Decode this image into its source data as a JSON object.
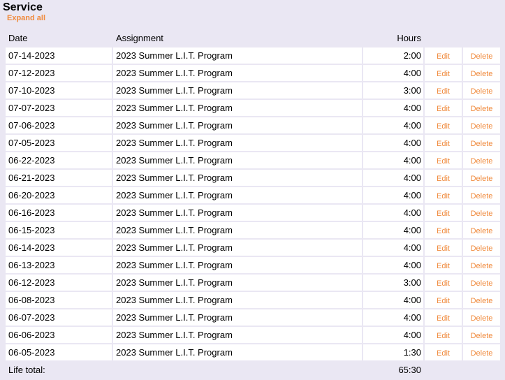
{
  "section": {
    "title": "Service",
    "expand_label": "Expand all"
  },
  "table": {
    "headers": {
      "date": "Date",
      "assignment": "Assignment",
      "hours": "Hours"
    },
    "edit_label": "Edit",
    "delete_label": "Delete",
    "rows": [
      {
        "date": "07-14-2023",
        "assignment": "2023 Summer L.I.T. Program",
        "hours": "2:00"
      },
      {
        "date": "07-12-2023",
        "assignment": "2023 Summer L.I.T. Program",
        "hours": "4:00"
      },
      {
        "date": "07-10-2023",
        "assignment": "2023 Summer L.I.T. Program",
        "hours": "3:00"
      },
      {
        "date": "07-07-2023",
        "assignment": "2023 Summer L.I.T. Program",
        "hours": "4:00"
      },
      {
        "date": "07-06-2023",
        "assignment": "2023 Summer L.I.T. Program",
        "hours": "4:00"
      },
      {
        "date": "07-05-2023",
        "assignment": "2023 Summer L.I.T. Program",
        "hours": "4:00"
      },
      {
        "date": "06-22-2023",
        "assignment": "2023 Summer L.I.T. Program",
        "hours": "4:00"
      },
      {
        "date": "06-21-2023",
        "assignment": "2023 Summer L.I.T. Program",
        "hours": "4:00"
      },
      {
        "date": "06-20-2023",
        "assignment": "2023 Summer L.I.T. Program",
        "hours": "4:00"
      },
      {
        "date": "06-16-2023",
        "assignment": "2023 Summer L.I.T. Program",
        "hours": "4:00"
      },
      {
        "date": "06-15-2023",
        "assignment": "2023 Summer L.I.T. Program",
        "hours": "4:00"
      },
      {
        "date": "06-14-2023",
        "assignment": "2023 Summer L.I.T. Program",
        "hours": "4:00"
      },
      {
        "date": "06-13-2023",
        "assignment": "2023 Summer L.I.T. Program",
        "hours": "4:00"
      },
      {
        "date": "06-12-2023",
        "assignment": "2023 Summer L.I.T. Program",
        "hours": "3:00"
      },
      {
        "date": "06-08-2023",
        "assignment": "2023 Summer L.I.T. Program",
        "hours": "4:00"
      },
      {
        "date": "06-07-2023",
        "assignment": "2023 Summer L.I.T. Program",
        "hours": "4:00"
      },
      {
        "date": "06-06-2023",
        "assignment": "2023 Summer L.I.T. Program",
        "hours": "4:00"
      },
      {
        "date": "06-05-2023",
        "assignment": "2023 Summer L.I.T. Program",
        "hours": "1:30"
      }
    ],
    "footer": {
      "label": "Life total:",
      "total": "65:30"
    }
  },
  "colors": {
    "background": "#eae7f3",
    "link": "#f08a3c",
    "row": "#ffffff"
  }
}
